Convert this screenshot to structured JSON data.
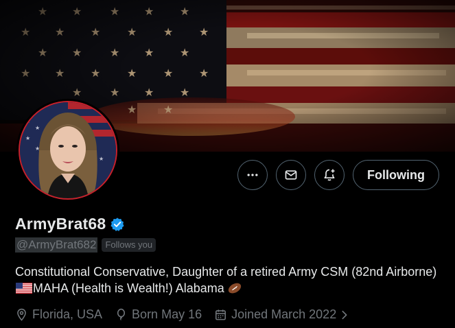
{
  "profile": {
    "display_name": "ArmyBrat68",
    "handle": "@ArmyBrat682",
    "follows_you": "Follows you",
    "verified": true,
    "bio_part1": "Constitutional Conservative, Daughter of a retired Army CSM (82nd Airborne)",
    "bio_part2": "MAHA (Health is Wealth!) Alabama",
    "bio_emojis": [
      "us-flag-icon",
      "football-icon"
    ],
    "location": "Florida, USA",
    "birthday": "Born May 16",
    "joined": "Joined March 2022"
  },
  "actions": {
    "more_icon": "more-icon",
    "message_icon": "mail-icon",
    "notify_icon": "bell-plus-icon",
    "follow_label": "Following"
  },
  "colors": {
    "background": "#000000",
    "text_primary": "#e7e9ea",
    "text_secondary": "#71767b",
    "verified_blue": "#1d9bf0",
    "border": "#536471",
    "avatar_ring": "#c8202a"
  },
  "icons": {
    "location": "location-pin-icon",
    "birthday": "balloon-icon",
    "joined": "calendar-icon",
    "expand": "chevron-right-icon"
  }
}
